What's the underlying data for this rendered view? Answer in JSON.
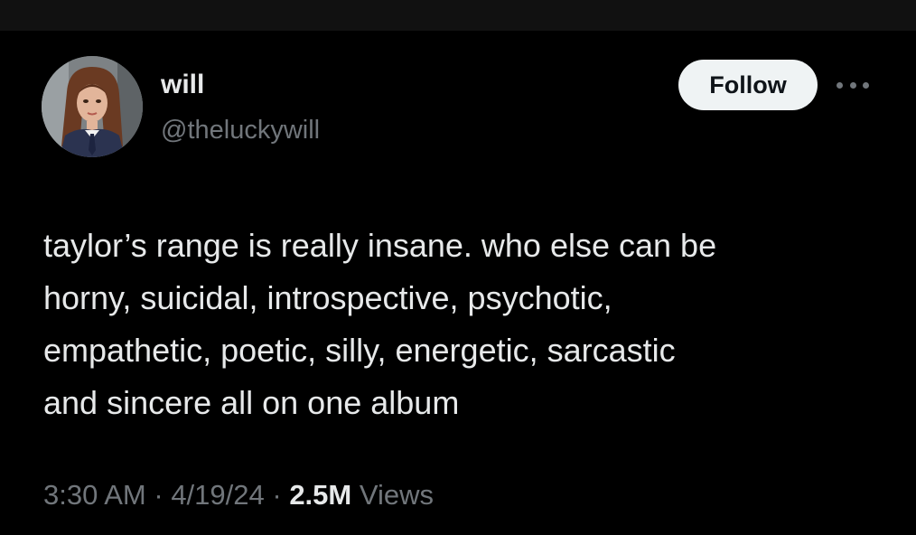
{
  "author": {
    "display_name": "will",
    "handle": "@theluckywill",
    "avatar_icon": "profile-photo"
  },
  "actions": {
    "follow_label": "Follow",
    "more_icon": "more-horizontal-icon"
  },
  "tweet": {
    "lines": [
      "taylor’s range is really insane. who else can be",
      "horny, suicidal, introspective, psychotic,",
      "empathetic, poetic, silly, energetic, sarcastic",
      "and sincere all on one album"
    ]
  },
  "meta": {
    "time": "3:30 AM",
    "separator": " · ",
    "date": "4/19/24",
    "views_count": "2.5M",
    "views_label": " Views"
  },
  "colors": {
    "background": "#000000",
    "primary_text": "#e7e9ea",
    "secondary_text": "#71767b",
    "follow_bg": "#eff3f4",
    "follow_text": "#0f1419"
  }
}
